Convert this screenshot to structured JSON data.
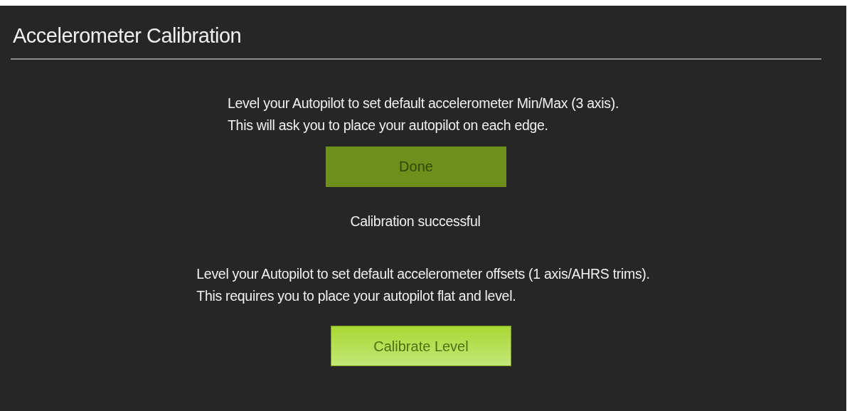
{
  "title": "Accelerometer Calibration",
  "sections": [
    {
      "lines": [
        "Level your Autopilot to set default accelerometer Min/Max (3 axis).",
        "This will ask you to place your autopilot on each edge."
      ],
      "button": {
        "label": "Done",
        "disabled": true
      },
      "status": "Calibration successful"
    },
    {
      "lines": [
        "Level your Autopilot to set default accelerometer offsets (1 axis/AHRS trims).",
        "This requires you to place your autopilot flat and level."
      ],
      "button": {
        "label": "Calibrate Level",
        "disabled": false
      }
    }
  ]
}
